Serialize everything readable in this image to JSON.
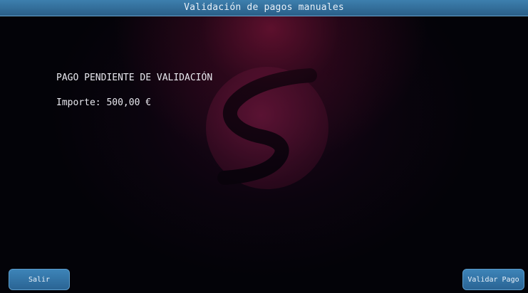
{
  "window": {
    "title": "Validación de pagos manuales"
  },
  "main": {
    "status_text": "PAGO PENDIENTE DE VALIDACIÓN",
    "amount_text": "Importe: 500,00 €"
  },
  "footer": {
    "exit_label": "Salir",
    "validate_label": "Validar Pago"
  },
  "theme": {
    "accent": "#2f6f9f",
    "background": "#030308",
    "glow": "#7a1437",
    "text": "#e8e8ee"
  },
  "icons": {
    "background_logo": "s-logo-icon"
  }
}
